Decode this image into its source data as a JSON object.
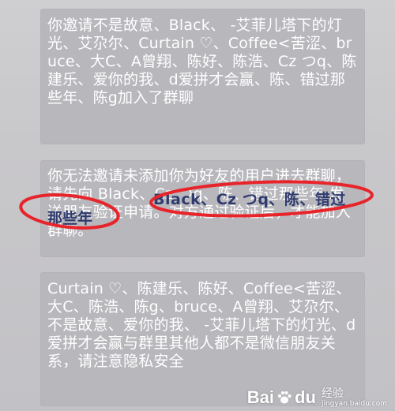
{
  "messages": [
    {
      "text": "你邀请不是故意、Black、 -艾菲儿塔下的灯光、艾尕尔、Curtain ♡、Coffee<苦涩、bruce、大C、A曾翔、陈好、陈浩、Cz つq、陈建乐、爱你的我、d爱拼才会赢、陈、错过那些年、陈g加入了群聊"
    },
    {
      "text": "你无法邀请未添加你为好友的用户进去群聊，请先向 Black、Cz つq、陈、错过那些年 发送朋友验证申请。对方通过验证后，才能加入群聊。"
    },
    {
      "text": "Curtain ♡、陈建乐、陈好、Coffee<苦涩、大C、陈浩、陈g、bruce、A曾翔、艾尕尔、不是故意、爱你的我、 -艾菲儿塔下的灯光、d爱拼才会赢与群里其他人都不是微信朋友关系，请注意隐私安全"
    }
  ],
  "highlights": {
    "names": "Black、Cz つq、陈、错过",
    "years": "那些年",
    "ellipse_color": "#e8242b"
  },
  "watermark": {
    "logo": "Bai",
    "logo_suffix": "du",
    "paw_icon": "baidu-paw-icon",
    "cn": "经验",
    "url": "jingyan.baidu.com"
  }
}
